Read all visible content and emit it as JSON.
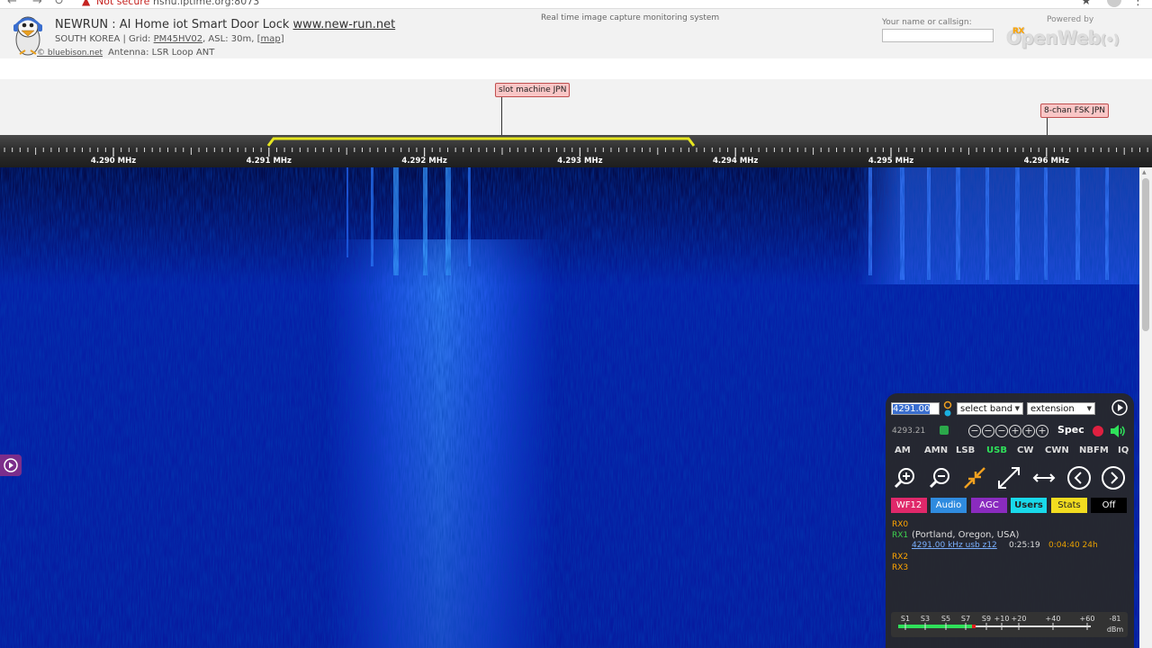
{
  "browser": {
    "security_label": "Not secure",
    "url": "nsnu.iptime.org:8073"
  },
  "header": {
    "title_prefix": "NEWRUN : AI Home iot Smart Door Lock ",
    "title_link": "www.new-run.net",
    "location_prefix": "SOUTH KOREA | Grid: ",
    "grid": "PM45HV02",
    "asl": ", ASL: 30m, [",
    "map_link": "map",
    "map_close": "]",
    "credit": "© bluebison.net",
    "antenna": "Antenna: LSR Loop ANT",
    "capture_text": "Real time image capture monitoring system",
    "callsign_label": "Your name or callsign:",
    "powered_by": "Powered by",
    "brand_main": "OpenWeb",
    "brand_rx": "RX",
    "brand_suffix": "(•)"
  },
  "bookmarks": [
    {
      "label": "slot machine JPN"
    },
    {
      "label": "8-chan FSK JPN"
    }
  ],
  "scale": {
    "labels": [
      "4.290 MHz",
      "4.291 MHz",
      "4.292 MHz",
      "4.293 MHz",
      "4.294 MHz",
      "4.295 MHz",
      "4.296 MHz"
    ],
    "passband_color": "#e6e620"
  },
  "panel": {
    "frequency": "4291.00",
    "band_select": "select band",
    "extension_select": "extension",
    "freq_small": "4293.21",
    "spec_label": "Spec",
    "modes": [
      "AM",
      "AMN",
      "LSB",
      "USB",
      "CW",
      "CWN",
      "NBFM",
      "IQ"
    ],
    "active_mode": "USB",
    "buttons": [
      {
        "label": "WF12",
        "color": "#e0286a"
      },
      {
        "label": "Audio",
        "color": "#2f8bdf"
      },
      {
        "label": "AGC",
        "color": "#8a2bbf"
      },
      {
        "label": "Users",
        "color": "#19d9ea"
      },
      {
        "label": "Stats",
        "color": "#f2dc20"
      },
      {
        "label": "Off",
        "color": "#000000"
      }
    ],
    "rx": {
      "rx0": "RX0",
      "rx1": "RX1",
      "rx1_location": "(Portland, Oregon, USA)",
      "rx1_link": "4291.00 kHz usb z12",
      "rx1_time": "0:25:19",
      "rx1_time2": "0:04:40 24h",
      "rx2": "RX2",
      "rx3": "RX3"
    },
    "smeter": {
      "labels": [
        "S1",
        "S3",
        "S5",
        "S7",
        "S9",
        "+10",
        "+20",
        "+40",
        "+60",
        "-81"
      ],
      "unit": "dBm"
    }
  }
}
